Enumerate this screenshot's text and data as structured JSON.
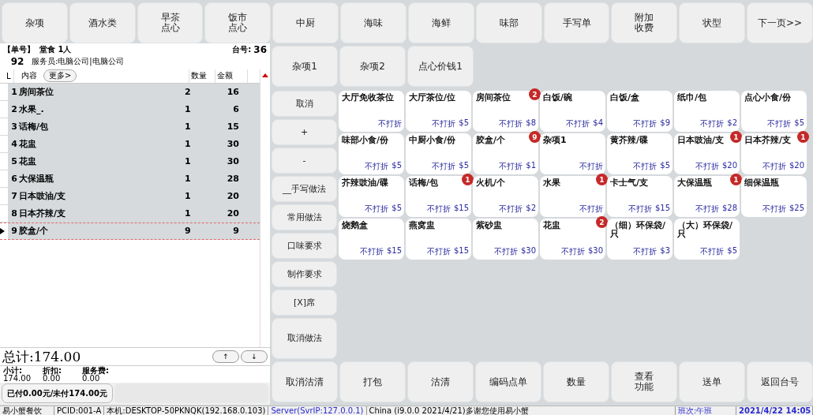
{
  "categories": [
    {
      "label": "杂项",
      "kind": "single"
    },
    {
      "label": "酒水类",
      "kind": "single"
    },
    {
      "label": "早茶点心",
      "kind": "stacked"
    },
    {
      "label": "饭市点心",
      "kind": "stacked"
    },
    {
      "label": "中厨",
      "kind": "single"
    },
    {
      "label": "海味",
      "kind": "single"
    },
    {
      "label": "海鲜",
      "kind": "single"
    },
    {
      "label": "味部",
      "kind": "single"
    },
    {
      "label": "手写单",
      "kind": "single"
    },
    {
      "label": "附加收费",
      "kind": "stacked"
    },
    {
      "label": "状型",
      "kind": "single"
    },
    {
      "label": "下一页>>",
      "kind": "single"
    }
  ],
  "subcategories": [
    "杂项1",
    "杂项2",
    "点心价钱1"
  ],
  "order": {
    "number_label": "【单号】",
    "number": "92",
    "type": "堂食 1人",
    "table_label": "台号:",
    "table": "36",
    "waiter": "服务员:电脑公司|电脑公司",
    "columns": {
      "line": "L",
      "content": "内容",
      "more": "更多>",
      "qty": "数量",
      "amount": "金额"
    },
    "rows": [
      {
        "no": "1",
        "name": "房间茶位",
        "qty": "2",
        "amount": "16",
        "selected": false
      },
      {
        "no": "2",
        "name": "水果_.",
        "qty": "1",
        "amount": "6",
        "selected": false
      },
      {
        "no": "3",
        "name": "话梅/包",
        "qty": "1",
        "amount": "15",
        "selected": false
      },
      {
        "no": "4",
        "name": "花盅",
        "qty": "1",
        "amount": "30",
        "selected": false
      },
      {
        "no": "5",
        "name": "花盅",
        "qty": "1",
        "amount": "30",
        "selected": false
      },
      {
        "no": "6",
        "name": "大保温瓶",
        "qty": "1",
        "amount": "28",
        "selected": false
      },
      {
        "no": "7",
        "name": "日本豉油/支",
        "qty": "1",
        "amount": "20",
        "selected": false
      },
      {
        "no": "8",
        "name": "日本芥辣/支",
        "qty": "1",
        "amount": "20",
        "selected": false
      },
      {
        "no": "9",
        "name": "胶盒/个",
        "qty": "9",
        "amount": "9",
        "selected": true
      }
    ],
    "total": "总计:174.00",
    "up": "↑",
    "down": "↓",
    "subtotals": [
      {
        "label": "小计:",
        "value": "174.00"
      },
      {
        "label": "折扣:",
        "value": "0.00"
      },
      {
        "label": "服务费:",
        "value": "0.00"
      }
    ],
    "paid": "已付0.00元/未付174.00元"
  },
  "actions": [
    "取消",
    "+",
    "-",
    "__手写做法",
    "常用做法",
    "口味要求",
    "制作要求",
    "[X]席",
    "取消做法"
  ],
  "items": [
    {
      "name": "大厅免收茶位",
      "note": "不打折"
    },
    {
      "name": "大厅茶位/位",
      "note": "不打折",
      "price": "$5"
    },
    {
      "name": "房间茶位",
      "note": "不打折",
      "price": "$8",
      "count": "2"
    },
    {
      "name": "白饭/碗",
      "note": "不打折",
      "price": "$4"
    },
    {
      "name": "白饭/盒",
      "note": "不打折",
      "price": "$9"
    },
    {
      "name": "纸巾/包",
      "note": "不打折",
      "price": "$2"
    },
    {
      "name": "点心小食/份",
      "note": "不打折",
      "price": "$5"
    },
    {
      "name": "味部小食/份",
      "note": "不打折",
      "price": "$5"
    },
    {
      "name": "中厨小食/份",
      "note": "不打折",
      "price": "$5"
    },
    {
      "name": "胶盒/个",
      "note": "不打折",
      "price": "$1",
      "count": "9"
    },
    {
      "name": "杂项1",
      "note": "不打折"
    },
    {
      "name": "黄芥辣/碟",
      "note": "不打折",
      "price": "$5"
    },
    {
      "name": "日本豉油/支",
      "note": "不打折",
      "price": "$20",
      "count": "1"
    },
    {
      "name": "日本芥辣/支",
      "note": "不打折",
      "price": "$20",
      "count": "1"
    },
    {
      "name": "芥辣豉油/碟",
      "note": "不打折",
      "price": "$5"
    },
    {
      "name": "话梅/包",
      "note": "不打折",
      "price": "$15",
      "count": "1"
    },
    {
      "name": "火机/个",
      "note": "不打折",
      "price": "$2"
    },
    {
      "name": "水果",
      "note": "不打折",
      "count": "1"
    },
    {
      "name": "卡士气/支",
      "note": "不打折",
      "price": "$15"
    },
    {
      "name": "大保温瓶",
      "note": "不打折",
      "price": "$28",
      "count": "1"
    },
    {
      "name": "细保温瓶",
      "note": "不打折",
      "price": "$25"
    },
    {
      "name": "烧鹅盒",
      "note": "不打折",
      "price": "$15"
    },
    {
      "name": "燕窝盅",
      "note": "不打折",
      "price": "$15"
    },
    {
      "name": "紫砂盅",
      "note": "不打折",
      "price": "$30"
    },
    {
      "name": "花盅",
      "note": "不打折",
      "price": "$30",
      "count": "2"
    },
    {
      "name": "（细）环保袋/只",
      "note": "不打折",
      "price": "$3"
    },
    {
      "name": "（大）环保袋/只",
      "note": "不打折",
      "price": "$5"
    }
  ],
  "bottom_buttons": [
    {
      "label": "取消沽清",
      "kind": "single"
    },
    {
      "label": "打包",
      "kind": "single"
    },
    {
      "label": "沽清",
      "kind": "single"
    },
    {
      "label": "编码点单",
      "kind": "single"
    },
    {
      "label": "数量",
      "kind": "single"
    },
    {
      "label": "查看功能",
      "kind": "stacked"
    },
    {
      "label": "送单",
      "kind": "single"
    },
    {
      "label": "返回台号",
      "kind": "single"
    }
  ],
  "status_bar": {
    "app": "易小蟹餐饮",
    "pcid": "PCID:001-A",
    "host": "本机:DESKTOP-50PKNQK(192.168.0.103)",
    "server": "Server(SvrIP:127.0.0.1)",
    "message": "China (i9.0.0 2021/4/21)多谢您使用易小蟹",
    "shift": "班次:午班",
    "datetime": "2021/4/22 14:05"
  }
}
